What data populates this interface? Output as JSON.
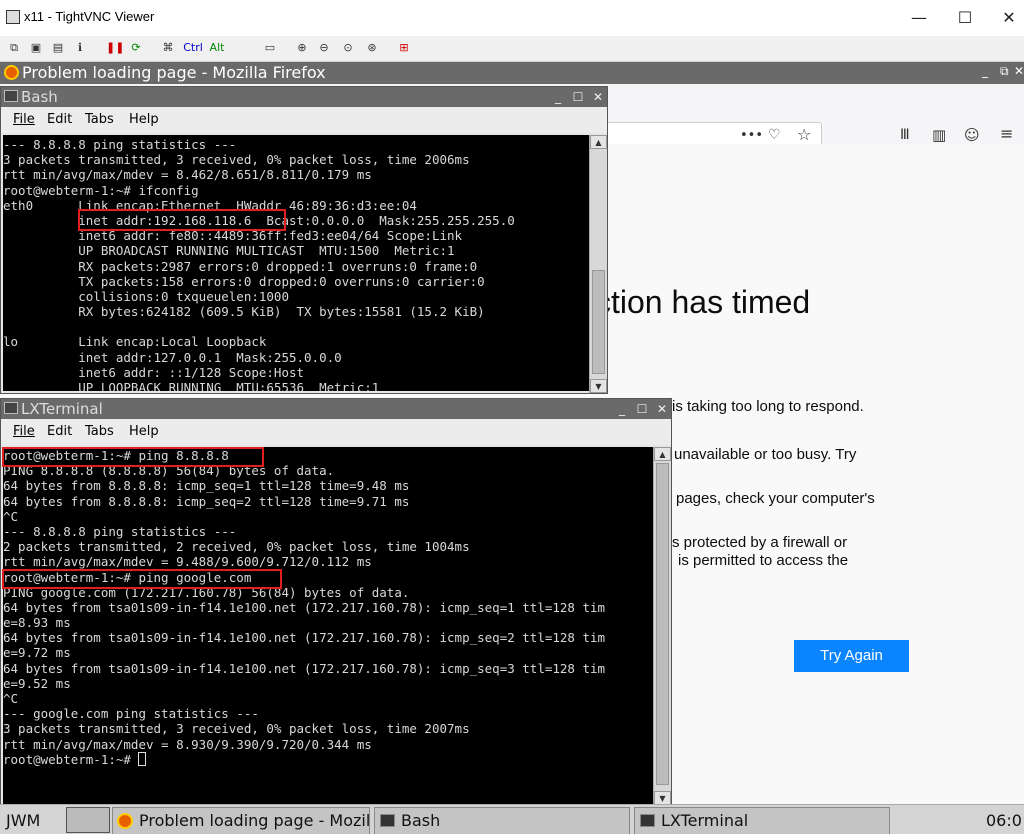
{
  "vnc": {
    "title": "x11 - TightVNC Viewer",
    "minimize": "—",
    "maximize": "☐",
    "close": "✕",
    "toolbar_ctrl": "Ctrl",
    "toolbar_alt": "Alt"
  },
  "firefox": {
    "title": "Problem loading page - Mozilla Firefox",
    "url_actions": "•••",
    "error_heading": "ction has timed",
    "lines": [
      "is taking too long to respond.",
      "unavailable or too busy. Try",
      "pages, check your computer's",
      "s protected by a firewall or",
      "is permitted to access the"
    ],
    "try_again": "Try Again"
  },
  "bash": {
    "title": "Bash",
    "menu": [
      "File",
      "Edit",
      "Tabs",
      "Help"
    ],
    "lines": [
      "--- 8.8.8.8 ping statistics ---",
      "3 packets transmitted, 3 received, 0% packet loss, time 2006ms",
      "rtt min/avg/max/mdev = 8.462/8.651/8.811/0.179 ms",
      "root@webterm-1:~# ifconfig",
      "eth0      Link encap:Ethernet  HWaddr 46:89:36:d3:ee:04",
      "          inet addr:192.168.118.6  Bcast:0.0.0.0  Mask:255.255.255.0",
      "          inet6 addr: fe80::4489:36ff:fed3:ee04/64 Scope:Link",
      "          UP BROADCAST RUNNING MULTICAST  MTU:1500  Metric:1",
      "          RX packets:2987 errors:0 dropped:1 overruns:0 frame:0",
      "          TX packets:158 errors:0 dropped:0 overruns:0 carrier:0",
      "          collisions:0 txqueuelen:1000",
      "          RX bytes:624182 (609.5 KiB)  TX bytes:15581 (15.2 KiB)",
      "",
      "lo        Link encap:Local Loopback",
      "          inet addr:127.0.0.1  Mask:255.0.0.0",
      "          inet6 addr: ::1/128 Scope:Host",
      "          UP LOOPBACK RUNNING  MTU:65536  Metric:1"
    ]
  },
  "lxterminal": {
    "title": "LXTerminal",
    "menu": [
      "File",
      "Edit",
      "Tabs",
      "Help"
    ],
    "lines": [
      "root@webterm-1:~# ping 8.8.8.8",
      "PING 8.8.8.8 (8.8.8.8) 56(84) bytes of data.",
      "64 bytes from 8.8.8.8: icmp_seq=1 ttl=128 time=9.48 ms",
      "64 bytes from 8.8.8.8: icmp_seq=2 ttl=128 time=9.71 ms",
      "^C",
      "--- 8.8.8.8 ping statistics ---",
      "2 packets transmitted, 2 received, 0% packet loss, time 1004ms",
      "rtt min/avg/max/mdev = 9.488/9.600/9.712/0.112 ms",
      "root@webterm-1:~# ping google.com",
      "PING google.com (172.217.160.78) 56(84) bytes of data.",
      "64 bytes from tsa01s09-in-f14.1e100.net (172.217.160.78): icmp_seq=1 ttl=128 tim",
      "e=8.93 ms",
      "64 bytes from tsa01s09-in-f14.1e100.net (172.217.160.78): icmp_seq=2 ttl=128 tim",
      "e=9.72 ms",
      "64 bytes from tsa01s09-in-f14.1e100.net (172.217.160.78): icmp_seq=3 ttl=128 tim",
      "e=9.52 ms",
      "^C",
      "--- google.com ping statistics ---",
      "3 packets transmitted, 3 received, 0% packet loss, time 2007ms",
      "rtt min/avg/max/mdev = 8.930/9.390/9.720/0.344 ms",
      "root@webterm-1:~# "
    ]
  },
  "taskbar": {
    "wm": "JWM",
    "items": [
      "Problem loading page - Mozill",
      "Bash",
      "LXTerminal"
    ],
    "clock": "06:0"
  }
}
